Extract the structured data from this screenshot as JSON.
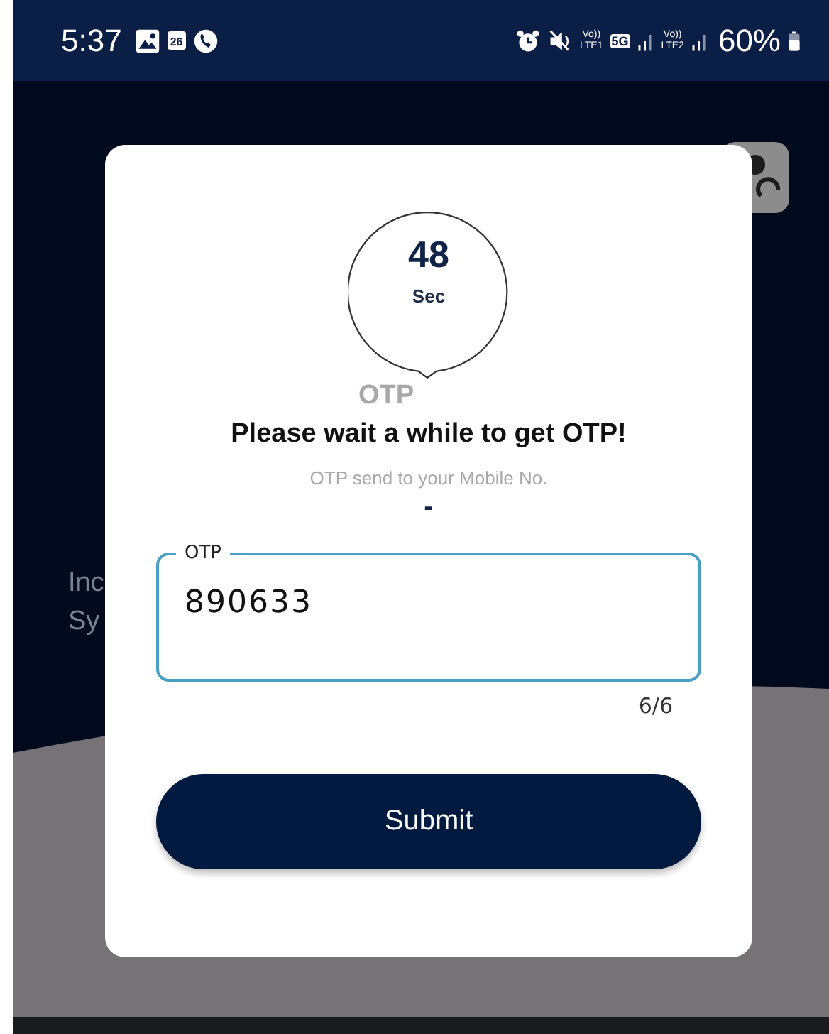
{
  "status_bar": {
    "time": "5:37",
    "calendar_day": "26",
    "networks": [
      {
        "top": "Vo))",
        "bottom": "LTE1"
      },
      {
        "top": "Vo))",
        "bottom": "LTE2"
      }
    ],
    "network_type": "5G",
    "battery": "60%"
  },
  "background": {
    "texts": [
      "Inc",
      "Sy"
    ]
  },
  "dialog": {
    "timer": {
      "value": "48",
      "unit": "Sec"
    },
    "otp_label": "OTP",
    "title": "Please wait a while to get OTP!",
    "subtitle": "OTP send to your Mobile No.",
    "mobile_number": "-",
    "otp_field": {
      "label": "OTP",
      "value": "890633",
      "counter": "6/6"
    },
    "submit_button": "Submit"
  }
}
